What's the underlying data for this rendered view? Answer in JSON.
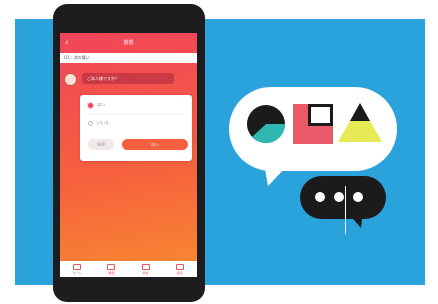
{
  "app": {
    "title": "質問",
    "back_icon": "chevron-left-icon",
    "topic": "Q1 : 涼の嗜い",
    "question": "ご本人様ですか？",
    "options": [
      {
        "label": "はい",
        "selected": true
      },
      {
        "label": "いいえ",
        "selected": false
      }
    ],
    "skip_label": "SKIP",
    "next_label": "次へ"
  },
  "tabs": [
    {
      "label": "ホーム",
      "icon": "home-icon"
    },
    {
      "label": "履歴",
      "icon": "history-icon"
    },
    {
      "label": "統計",
      "icon": "chart-icon"
    },
    {
      "label": "設定",
      "icon": "settings-icon"
    }
  ],
  "colors": {
    "panel": "#2aa3dc",
    "gradient_top": "#f0455a",
    "gradient_bottom": "#f98a30",
    "pie_teal": "#2fb8b1",
    "square_red": "#e85a6a",
    "triangle_yellow": "#e6ea55"
  }
}
